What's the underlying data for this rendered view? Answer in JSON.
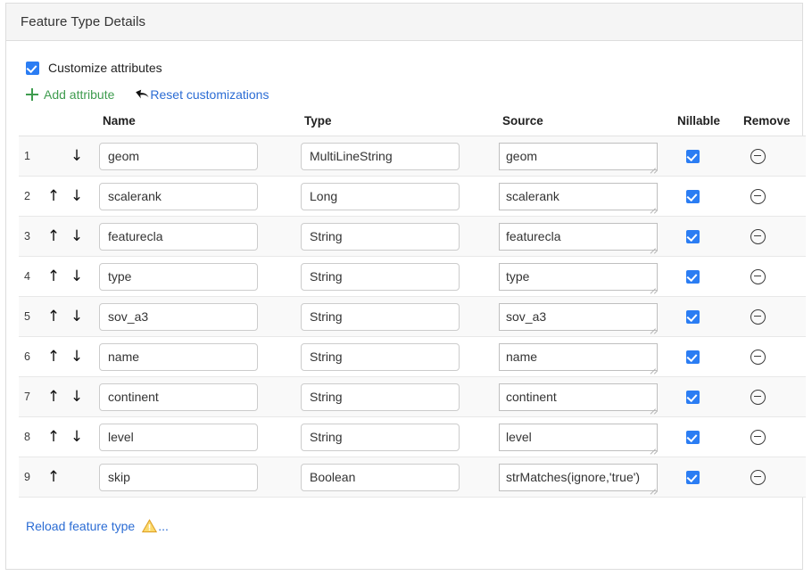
{
  "panel": {
    "title": "Feature Type Details"
  },
  "customize": {
    "checked": true,
    "label": "Customize attributes",
    "checkbox_color": "#2b7df3"
  },
  "actions": {
    "add_label": "Add attribute",
    "add_icon": "plus-icon",
    "add_color": "#3f9c4f",
    "reset_label": "Reset customizations",
    "reset_icon": "undo-arrow-icon",
    "reset_color": "#2b6cd4"
  },
  "table": {
    "headers": {
      "index": "",
      "move": "",
      "name": "Name",
      "type": "Type",
      "source": "Source",
      "nillable": "Nillable",
      "remove": "Remove"
    },
    "rows": [
      {
        "index": "1",
        "name": "geom",
        "type": "MultiLineString",
        "source": "geom",
        "nillable": true,
        "can_move_up": false,
        "can_move_down": true
      },
      {
        "index": "2",
        "name": "scalerank",
        "type": "Long",
        "source": "scalerank",
        "nillable": true,
        "can_move_up": true,
        "can_move_down": true
      },
      {
        "index": "3",
        "name": "featurecla",
        "type": "String",
        "source": "featurecla",
        "nillable": true,
        "can_move_up": true,
        "can_move_down": true
      },
      {
        "index": "4",
        "name": "type",
        "type": "String",
        "source": "type",
        "nillable": true,
        "can_move_up": true,
        "can_move_down": true
      },
      {
        "index": "5",
        "name": "sov_a3",
        "type": "String",
        "source": "sov_a3",
        "nillable": true,
        "can_move_up": true,
        "can_move_down": true
      },
      {
        "index": "6",
        "name": "name",
        "type": "String",
        "source": "name",
        "nillable": true,
        "can_move_up": true,
        "can_move_down": true
      },
      {
        "index": "7",
        "name": "continent",
        "type": "String",
        "source": "continent",
        "nillable": true,
        "can_move_up": true,
        "can_move_down": true
      },
      {
        "index": "8",
        "name": "level",
        "type": "String",
        "source": "level",
        "nillable": true,
        "can_move_up": true,
        "can_move_down": true
      },
      {
        "index": "9",
        "name": "skip",
        "type": "Boolean",
        "source": "strMatches(ignore,'true')",
        "nillable": true,
        "can_move_up": true,
        "can_move_down": false
      }
    ],
    "arrow_up_glyph": "↑",
    "arrow_down_glyph": "↓",
    "remove_icon": "minus-circle-icon"
  },
  "footer": {
    "reload_label": "Reload feature type",
    "warning_icon": "warning-triangle-icon",
    "warning_color": "#f0ad2e",
    "ellipsis": "..."
  }
}
